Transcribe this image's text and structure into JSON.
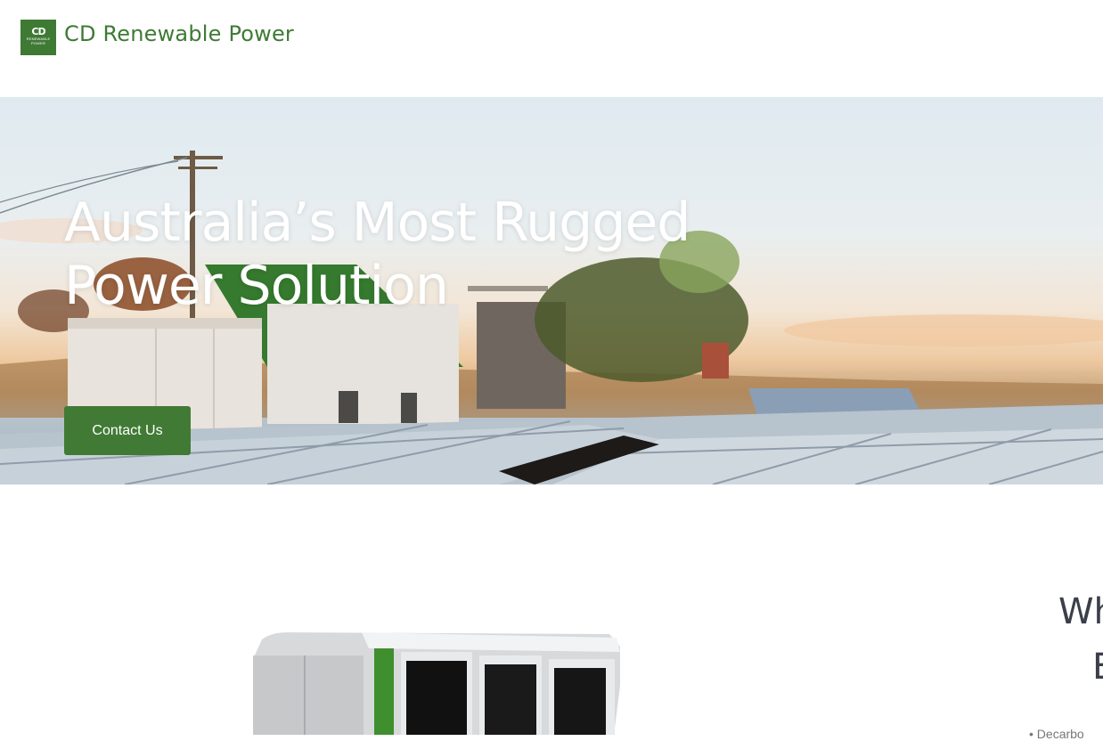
{
  "header": {
    "logo": {
      "mark": "CD",
      "sub": "RENEWABLE POWER",
      "color": "#3f7a35"
    },
    "brand_name": "CD Renewable Power"
  },
  "hero": {
    "title_line1": "Australia’s Most Rugged",
    "title_line2": "Power Solution",
    "cta_label": "Contact Us",
    "cta_color": "#417a34"
  },
  "section": {
    "heading_line1": "Wh",
    "heading_line2": "E",
    "bullet_partial": "Decarbo"
  }
}
